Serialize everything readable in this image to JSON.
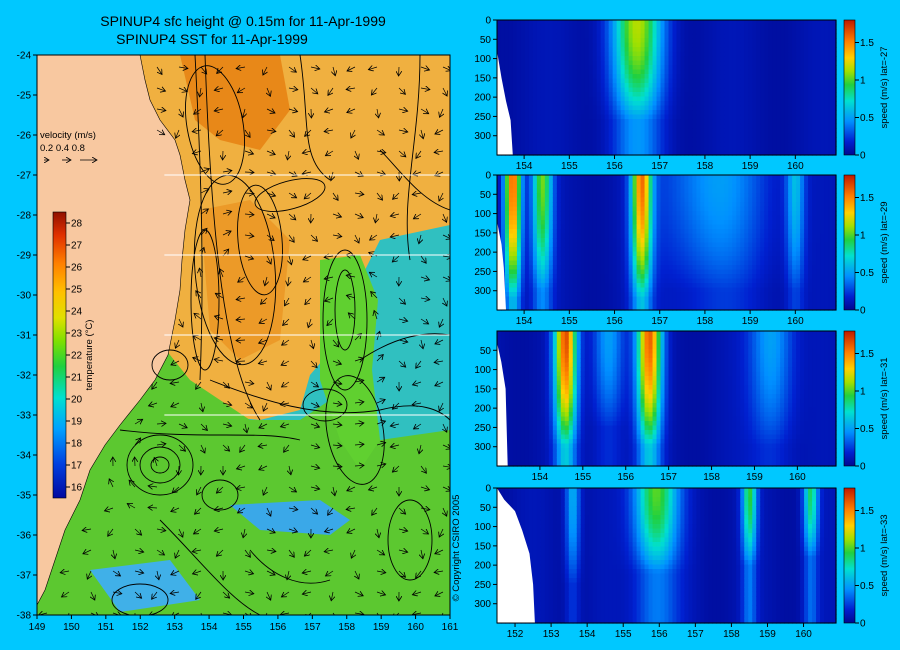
{
  "title_line1": "SPINUP4 sfc height @ 0.15m for 11-Apr-1999",
  "title_line2": "SPINUP4 SST for 11-Apr-1999",
  "copyright": "© Copyright CSIRO 2005",
  "velocity_legend": {
    "title": "velocity (m/s)",
    "values": [
      "0.2",
      "0.4",
      "0.8"
    ]
  },
  "temperature_colorbar": {
    "label": "temperature (°C)",
    "min": 15.5,
    "max": 28.5,
    "ticks": [
      "16",
      "17",
      "18",
      "19",
      "20",
      "21",
      "22",
      "23",
      "24",
      "25",
      "26",
      "27",
      "28"
    ]
  },
  "colors": {
    "background": "#00c8ff",
    "land": "#f8c8a0"
  },
  "chart_data": [
    {
      "type": "heatmap",
      "name": "map",
      "title": "SPINUP4 SST for 11-Apr-1999",
      "xlabel": "",
      "ylabel": "",
      "x_ticks": [
        "149",
        "150",
        "151",
        "152",
        "153",
        "154",
        "155",
        "156",
        "157",
        "158",
        "159",
        "160",
        "161"
      ],
      "y_ticks": [
        "-24",
        "-25",
        "-26",
        "-27",
        "-28",
        "-29",
        "-30",
        "-31",
        "-32",
        "-33",
        "-34",
        "-35",
        "-36",
        "-37",
        "-38"
      ],
      "xlim": [
        149,
        161
      ],
      "ylim": [
        -38,
        -24
      ],
      "transect_lats": [
        -27,
        -29,
        -31,
        -33
      ]
    },
    {
      "type": "heatmap",
      "name": "section-27",
      "colorbar_label": "speed (m/s) lat=-27",
      "x_ticks": [
        "154",
        "155",
        "156",
        "157",
        "158",
        "159",
        "160"
      ],
      "y_ticks": [
        "0",
        "50",
        "100",
        "150",
        "200",
        "250",
        "300"
      ],
      "cbar_ticks": [
        "0",
        "0.5",
        "1",
        "1.5"
      ],
      "xlim": [
        153.4,
        160.9
      ],
      "ylim": [
        350,
        0
      ],
      "vmax": 1.8,
      "jets": [
        {
          "lon": 156.5,
          "peak": 1.05,
          "width": 0.55,
          "depth": 260
        }
      ],
      "coast": [
        [
          153.4,
          80
        ],
        [
          153.5,
          150
        ],
        [
          153.6,
          210
        ],
        [
          153.7,
          260
        ],
        [
          153.75,
          350
        ]
      ]
    },
    {
      "type": "heatmap",
      "name": "section-29",
      "colorbar_label": "speed (m/s) lat=-29",
      "x_ticks": [
        "154",
        "155",
        "156",
        "157",
        "158",
        "159",
        "160"
      ],
      "y_ticks": [
        "0",
        "50",
        "100",
        "150",
        "200",
        "250",
        "300"
      ],
      "cbar_ticks": [
        "0",
        "0.5",
        "1",
        "1.5"
      ],
      "xlim": [
        153.4,
        160.9
      ],
      "ylim": [
        350,
        0
      ],
      "vmax": 1.8,
      "jets": [
        {
          "lon": 153.75,
          "peak": 1.55,
          "width": 0.18,
          "depth": 320
        },
        {
          "lon": 154.4,
          "peak": 0.95,
          "width": 0.22,
          "depth": 300
        },
        {
          "lon": 156.6,
          "peak": 1.4,
          "width": 0.22,
          "depth": 320
        },
        {
          "lon": 158.2,
          "peak": 0.4,
          "width": 1.2,
          "depth": 300
        },
        {
          "lon": 160.0,
          "peak": 0.5,
          "width": 0.2,
          "depth": 300
        }
      ],
      "coast": [
        [
          153.4,
          120
        ],
        [
          153.5,
          180
        ],
        [
          153.55,
          240
        ],
        [
          153.6,
          350
        ]
      ]
    },
    {
      "type": "heatmap",
      "name": "section-31",
      "colorbar_label": "speed (m/s) lat=-31",
      "x_ticks": [
        "154",
        "155",
        "156",
        "157",
        "158",
        "159",
        "160"
      ],
      "y_ticks": [
        "50",
        "100",
        "150",
        "200",
        "250",
        "300"
      ],
      "cbar_ticks": [
        "0",
        "0.5",
        "1",
        "1.5"
      ],
      "xlim": [
        153.0,
        160.9
      ],
      "ylim": [
        350,
        0
      ],
      "vmax": 1.8,
      "jets": [
        {
          "lon": 154.6,
          "peak": 1.55,
          "width": 0.25,
          "depth": 300
        },
        {
          "lon": 156.55,
          "peak": 1.5,
          "width": 0.28,
          "depth": 300
        },
        {
          "lon": 155.6,
          "peak": 0.45,
          "width": 0.35,
          "depth": 250
        },
        {
          "lon": 159.4,
          "peak": 0.45,
          "width": 0.5,
          "depth": 300
        }
      ],
      "coast": [
        [
          153.0,
          30
        ],
        [
          153.1,
          80
        ],
        [
          153.2,
          150
        ],
        [
          153.25,
          350
        ]
      ]
    },
    {
      "type": "heatmap",
      "name": "section-33",
      "colorbar_label": "speed (m/s) lat=-33",
      "x_ticks": [
        "152",
        "153",
        "154",
        "155",
        "156",
        "157",
        "158",
        "159",
        "160"
      ],
      "y_ticks": [
        "0",
        "50",
        "100",
        "150",
        "200",
        "250",
        "300"
      ],
      "cbar_ticks": [
        "0",
        "0.5",
        "1",
        "1.5"
      ],
      "xlim": [
        151.5,
        160.9
      ],
      "ylim": [
        350,
        0
      ],
      "vmax": 1.8,
      "jets": [
        {
          "lon": 155.9,
          "peak": 0.95,
          "width": 0.6,
          "depth": 220
        },
        {
          "lon": 158.5,
          "peak": 0.85,
          "width": 0.2,
          "depth": 200
        },
        {
          "lon": 160.2,
          "peak": 0.8,
          "width": 0.2,
          "depth": 180
        },
        {
          "lon": 153.6,
          "peak": 0.5,
          "width": 0.2,
          "depth": 250
        }
      ],
      "coast": [
        [
          151.5,
          0
        ],
        [
          151.7,
          30
        ],
        [
          152.0,
          60
        ],
        [
          152.2,
          110
        ],
        [
          152.4,
          170
        ],
        [
          152.5,
          250
        ],
        [
          152.55,
          350
        ]
      ]
    }
  ]
}
